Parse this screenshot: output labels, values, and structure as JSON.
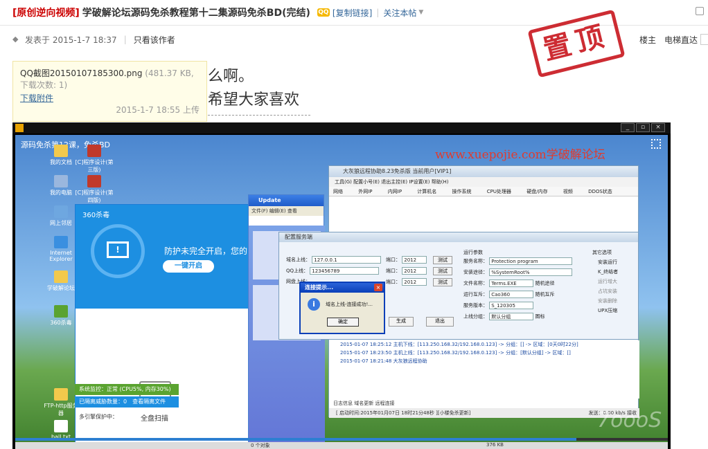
{
  "thread": {
    "tag": "[原创逆向视频]",
    "title": "学破解论坛源码免杀教程第十二集源码免杀BD(完结)",
    "copy_link": "[复制链接]",
    "follow": "关注本帖"
  },
  "meta": {
    "posted": "发表于 2015-1-7 18:37",
    "only_author": "只看该作者",
    "floor_owner": "楼主",
    "floor_jump": "电梯直达"
  },
  "stamp": "置顶",
  "post": {
    "line1": "么啊。",
    "line2": "希望大家喜欢"
  },
  "attachment": {
    "filename": "QQ截图20150107185300.png",
    "size_info": "(481.37 KB, 下载次数: 1)",
    "download": "下载附件",
    "time": "2015-1-7 18:55 上传"
  },
  "video": {
    "title": "源码免杀第12课，免杀BD",
    "watermark": "www.xuepojie.com学破解论坛",
    "progress": 0.86,
    "desktop_icons": [
      {
        "label": "我的文档",
        "color": "#f2c94c"
      },
      {
        "label": "我的电脑",
        "color": "#9ab7de"
      },
      {
        "label": "网上邻居",
        "color": "#6ea7e0"
      },
      {
        "label": "Internet Explorer",
        "color": "#3a8fe0"
      },
      {
        "label": "学破解论坛",
        "color": "#f2c94c"
      },
      {
        "label": "360杀毒",
        "color": "#5aa330"
      },
      {
        "label": "FTP-http服务器",
        "color": "#f2c94c"
      },
      {
        "label": "ball.txt",
        "color": "#ffffff"
      }
    ],
    "shortcuts": [
      {
        "label": "[C]程序设计(第三版)"
      },
      {
        "label": "[C]程序设计(第四版)"
      }
    ],
    "av360": {
      "title": "360杀毒",
      "warning": "防护未完全开启，您的",
      "button": "一键开启",
      "scan": "全盘扫描",
      "status": "系统监控：正常 (CPU5%, 内存30%)",
      "isolated": "已隔离威胁数量：0　查看隔离文件",
      "engines": "多引擎保护中："
    },
    "explorer": {
      "title": "Update",
      "menu": "文件(F)  编辑(E)  查看"
    },
    "remote": {
      "title": "大灰狼远程协助8.23免杀版  当前用户[VIP1]",
      "menu": "工具(G)  配置小号(E)  退出主控(E)  IP设置(E)  帮助(H)",
      "columns": [
        "网络",
        "外网IP",
        "内网IP",
        "计算机名",
        "操作系统",
        "CPU处理器",
        "硬盘/内存",
        "视频",
        "DDOS状态"
      ],
      "logs": [
        "2015-01-07 18:25:12   主机下线：[113.250.168.32/192.168.0.123] -> 分组：[] -> 区域：[0天0时22分]",
        "2015-01-07 18:23:50   主机上线：[113.250.168.32/192.168.0.123] -> 分组：[默认分组] -> 区域：[]",
        "2015-01-07 18:21:48   大灰狼远程协助"
      ],
      "tabs": "日志信息   域名更新   远程连接",
      "status": "[ 启动时间:2015年01月07日 18时21分48秒 ][小楼免杀更新]",
      "speed": "发送：0.00 kb/s  接收"
    },
    "config": {
      "title": "配置服务端",
      "domain_label": "域名上线：",
      "domain_value": "127.0.0.1",
      "qq_label": "QQ上线：",
      "qq_value": "123456789",
      "net_label": "网盘上线：",
      "port_label": "端口：",
      "port_value": "2012",
      "test": "测试",
      "run_params": "运行参数",
      "service_label": "服务名称：",
      "service_value": "Protection program",
      "install_label": "安装途径：",
      "install_value": "%SystemRoot%",
      "file_label": "文件名称：",
      "file_value": "Terms.EXE",
      "random1": "随机途径",
      "mutex_label": "运行互斥：",
      "mutex_value": "Cao360",
      "random2": "随机互斥",
      "version_label": "服务版本：",
      "version_value": "S_120305",
      "group_label": "上线分组：",
      "group_value": "默认分组",
      "icon_label": "图标",
      "other_opts": "其它选项",
      "opts": [
        "安装运行",
        "K_终结者",
        "运行增大",
        "占坑安装",
        "安装删除",
        "UPX压缩"
      ],
      "generate": "生成",
      "exit": "退出"
    },
    "msgbox": {
      "title": "连接提示...",
      "text": "域名上线-连接成功!...",
      "ok": "确定"
    },
    "bottom_left": "0 个对象",
    "bottom_size": "376 KB",
    "brand": "7oooS"
  },
  "colors": {
    "accent": "#336699",
    "stamp": "#c8161d",
    "tag": "#cc0000"
  }
}
